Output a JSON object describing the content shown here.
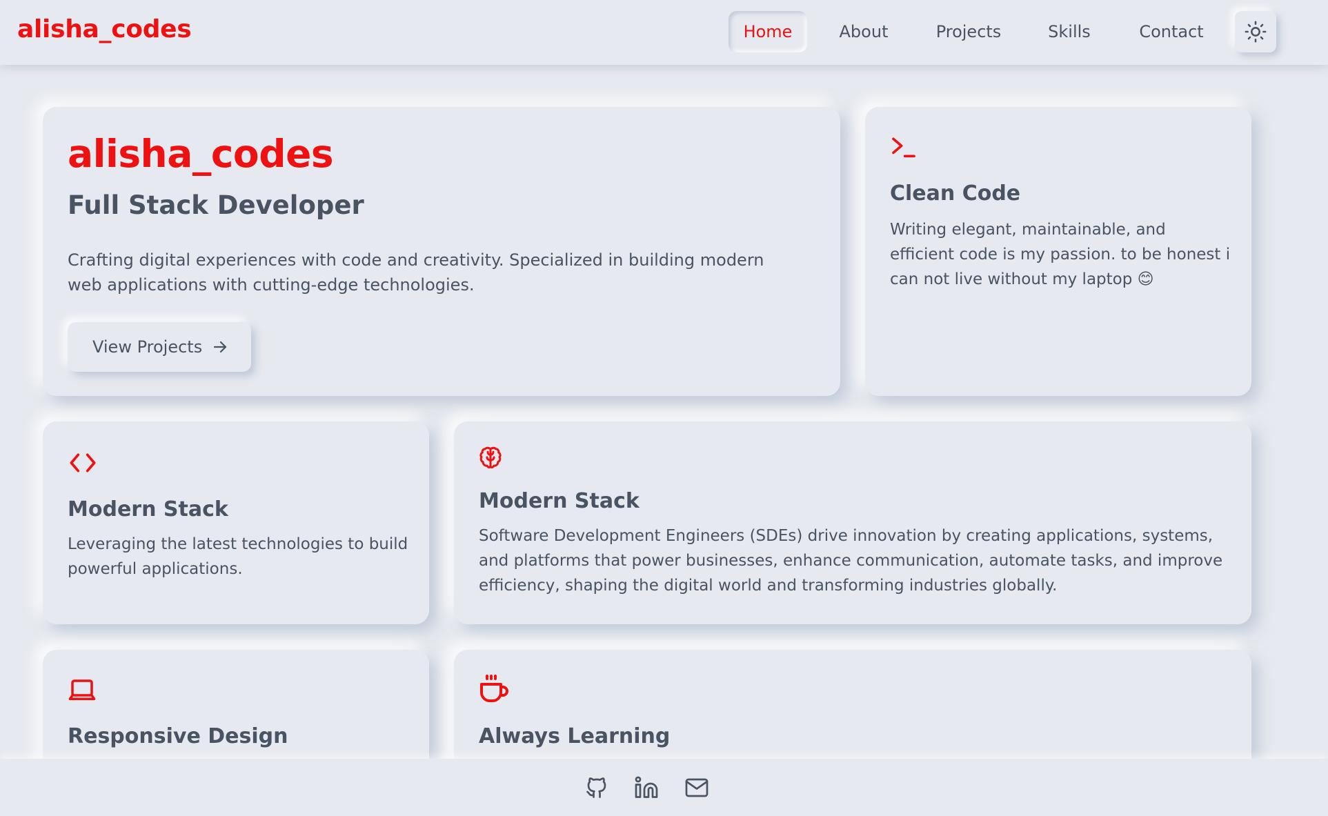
{
  "header": {
    "brand": "alisha_codes",
    "nav": [
      {
        "label": "Home",
        "active": true
      },
      {
        "label": "About",
        "active": false
      },
      {
        "label": "Projects",
        "active": false
      },
      {
        "label": "Skills",
        "active": false
      },
      {
        "label": "Contact",
        "active": false
      }
    ],
    "theme_toggle_icon": "sun-icon"
  },
  "hero": {
    "title": "alisha_codes",
    "subtitle": "Full Stack Developer",
    "description": "Crafting digital experiences with code and creativity. Specialized in building modern web applications with cutting-edge technologies.",
    "button_label": "View Projects",
    "button_icon": "arrow-right-icon"
  },
  "cards": [
    {
      "icon": "terminal-icon",
      "title": "Clean Code",
      "text": "Writing elegant, maintainable, and efficient code is my passion. to be honest i can not live without my laptop 😊"
    },
    {
      "icon": "code-icon",
      "title": "Modern Stack",
      "text": "Leveraging the latest technologies to build powerful applications."
    },
    {
      "icon": "brain-icon",
      "title": "Modern Stack",
      "text": "Software Development Engineers (SDEs) drive innovation by creating applications, systems, and platforms that power businesses, enhance communication, automate tasks, and improve efficiency, shaping the digital world and transforming industries globally."
    },
    {
      "icon": "laptop-icon",
      "title": "Responsive Design",
      "text": ""
    },
    {
      "icon": "coffee-icon",
      "title": "Always Learning",
      "text": ""
    }
  ],
  "footer": {
    "links": [
      {
        "icon": "github-icon"
      },
      {
        "icon": "linkedin-icon"
      },
      {
        "icon": "mail-icon"
      }
    ]
  },
  "colors": {
    "accent": "#ee1111",
    "background": "#e6e9ef",
    "text": "#4a5361"
  }
}
